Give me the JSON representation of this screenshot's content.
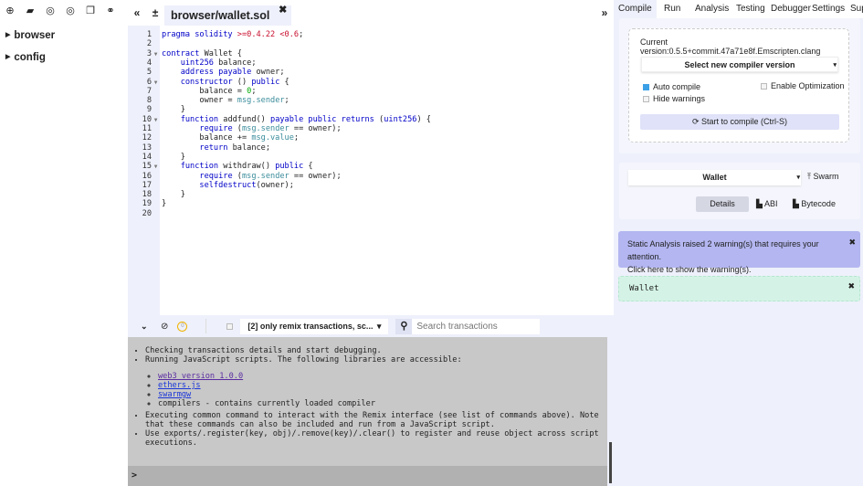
{
  "sidebar": {
    "icons": [
      "plus-circle-icon",
      "folder-open-icon",
      "github-icon",
      "github-icon",
      "copy-icon",
      "link-icon"
    ],
    "items": [
      {
        "label": "browser"
      },
      {
        "label": "config"
      }
    ]
  },
  "editor": {
    "tab": "browser/wallet.sol",
    "code": [
      [
        [
          "pragma solidity ",
          "k"
        ],
        [
          ">=0.4.22 <0.6",
          "r"
        ],
        [
          ";",
          ""
        ]
      ],
      [],
      [
        [
          "contract",
          "k"
        ],
        [
          " Wallet {",
          ""
        ]
      ],
      [
        [
          "    ",
          ""
        ],
        [
          "uint256",
          "k"
        ],
        [
          " balance;",
          ""
        ]
      ],
      [
        [
          "    ",
          ""
        ],
        [
          "address payable",
          "k"
        ],
        [
          " owner;",
          ""
        ]
      ],
      [
        [
          "    ",
          ""
        ],
        [
          "constructor",
          "k"
        ],
        [
          " () ",
          ""
        ],
        [
          "public",
          "k"
        ],
        [
          " {",
          ""
        ]
      ],
      [
        [
          "        balance = ",
          ""
        ],
        [
          "0",
          "n"
        ],
        [
          ";",
          ""
        ]
      ],
      [
        [
          "        owner = ",
          ""
        ],
        [
          "msg.sender",
          "m"
        ],
        [
          ";",
          ""
        ]
      ],
      [
        [
          "    }",
          ""
        ]
      ],
      [
        [
          "    ",
          ""
        ],
        [
          "function",
          "k"
        ],
        [
          " addfund() ",
          ""
        ],
        [
          "payable public returns",
          "k"
        ],
        [
          " (",
          ""
        ],
        [
          "uint256",
          "k"
        ],
        [
          ") {",
          ""
        ]
      ],
      [
        [
          "        ",
          ""
        ],
        [
          "require",
          "k"
        ],
        [
          " (",
          ""
        ],
        [
          "msg.sender",
          "m"
        ],
        [
          " == owner);",
          ""
        ]
      ],
      [
        [
          "        balance += ",
          ""
        ],
        [
          "msg.value",
          "m"
        ],
        [
          ";",
          ""
        ]
      ],
      [
        [
          "        ",
          ""
        ],
        [
          "return",
          "k"
        ],
        [
          " balance;",
          ""
        ]
      ],
      [
        [
          "    }",
          ""
        ]
      ],
      [
        [
          "    ",
          ""
        ],
        [
          "function",
          "k"
        ],
        [
          " withdraw() ",
          ""
        ],
        [
          "public",
          "k"
        ],
        [
          " {",
          ""
        ]
      ],
      [
        [
          "        ",
          ""
        ],
        [
          "require",
          "k"
        ],
        [
          " (",
          ""
        ],
        [
          "msg.sender",
          "m"
        ],
        [
          " == owner);",
          ""
        ]
      ],
      [
        [
          "        ",
          ""
        ],
        [
          "selfdestruct",
          "k"
        ],
        [
          "(owner);",
          ""
        ]
      ],
      [
        [
          "    }",
          ""
        ]
      ],
      [
        [
          "}",
          ""
        ]
      ],
      []
    ],
    "foldable_lines": [
      3,
      6,
      10,
      15
    ]
  },
  "terminal": {
    "filter_label": "[2] only remix transactions, sc...",
    "search_placeholder": "Search transactions",
    "pending_count": "0",
    "items": [
      "Checking transactions details and start debugging.",
      "Running JavaScript scripts. The following libraries are accessible:"
    ],
    "libs": [
      "web3 version 1.0.0",
      "ethers.js",
      "swarmgw"
    ],
    "libs_text": "compilers - contains currently loaded compiler",
    "items2": [
      "Executing common command to interact with the Remix interface (see list of commands above). Note that these commands can also be included and run from a JavaScript script.",
      "Use exports/.register(key, obj)/.remove(key)/.clear() to register and reuse object across script executions."
    ],
    "prompt": ">"
  },
  "right": {
    "tabs": [
      "Compile",
      "Run",
      "Analysis",
      "Testing",
      "Debugger",
      "Settings",
      "Sup"
    ],
    "active_tab": "Compile",
    "version": "Current version:0.5.5+commit.47a71e8f.Emscripten.clang",
    "select_version": "Select new compiler version",
    "auto_compile": "Auto compile",
    "auto_compile_checked": true,
    "enable_optimization": "Enable Optimization",
    "enable_optimization_checked": false,
    "hide_warnings": "Hide warnings",
    "hide_warnings_checked": false,
    "compile_button": "Start to compile (Ctrl-S)",
    "contract": "Wallet",
    "swarm": "Swarm",
    "details": "Details",
    "abi": "ABI",
    "bytecode": "Bytecode",
    "warning": "Static Analysis raised 2 warning(s) that requires your attention.",
    "warning_link": "Click here to show the warning(s).",
    "result": "Wallet"
  },
  "colors": {
    "accent": "#3ca0e6",
    "warning_bg": "#b3b6f0",
    "success_bg": "#d4f3e6",
    "panel_bg": "#eef0fb",
    "terminal_bg": "#c8c8c8"
  }
}
